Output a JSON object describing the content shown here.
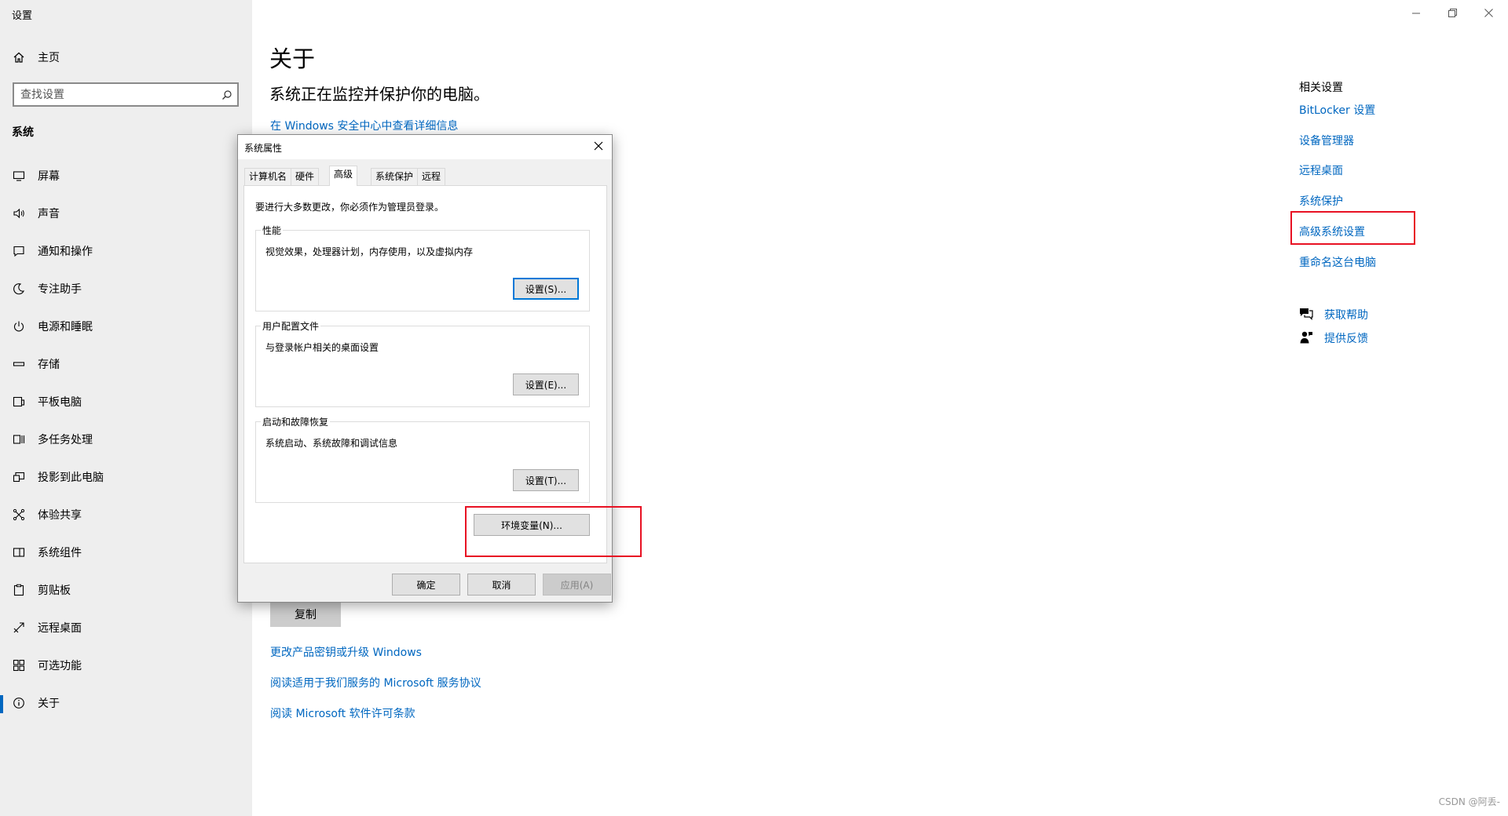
{
  "window": {
    "app_title": "设置"
  },
  "sidebar": {
    "home_label": "主页",
    "search_placeholder": "查找设置",
    "section_label": "系统",
    "items": [
      {
        "label": "屏幕",
        "icon": "monitor-icon"
      },
      {
        "label": "声音",
        "icon": "speaker-icon"
      },
      {
        "label": "通知和操作",
        "icon": "notification-icon"
      },
      {
        "label": "专注助手",
        "icon": "moon-icon"
      },
      {
        "label": "电源和睡眠",
        "icon": "power-icon"
      },
      {
        "label": "存储",
        "icon": "storage-icon"
      },
      {
        "label": "平板电脑",
        "icon": "tablet-icon"
      },
      {
        "label": "多任务处理",
        "icon": "multitask-icon"
      },
      {
        "label": "投影到此电脑",
        "icon": "project-icon"
      },
      {
        "label": "体验共享",
        "icon": "share-icon"
      },
      {
        "label": "系统组件",
        "icon": "components-icon"
      },
      {
        "label": "剪贴板",
        "icon": "clipboard-icon"
      },
      {
        "label": "远程桌面",
        "icon": "remote-icon"
      },
      {
        "label": "可选功能",
        "icon": "features-icon"
      },
      {
        "label": "关于",
        "icon": "info-icon",
        "active": true
      }
    ]
  },
  "main": {
    "title": "关于",
    "subtitle": "系统正在监控并保护你的电脑。",
    "security_link": "在 Windows 安全中心中查看详细信息",
    "copy_button": "复制",
    "links": [
      "更改产品密钥或升级 Windows",
      "阅读适用于我们服务的 Microsoft 服务协议",
      "阅读 Microsoft 软件许可条款"
    ]
  },
  "related": {
    "title": "相关设置",
    "links": [
      "BitLocker 设置",
      "设备管理器",
      "远程桌面",
      "系统保护",
      "高级系统设置",
      "重命名这台电脑"
    ],
    "help": [
      {
        "label": "获取帮助",
        "icon": "help-chat-icon"
      },
      {
        "label": "提供反馈",
        "icon": "feedback-icon"
      }
    ]
  },
  "dialog": {
    "title": "系统属性",
    "tabs": [
      "计算机名",
      "硬件",
      "高级",
      "系统保护",
      "远程"
    ],
    "active_tab": "高级",
    "admin_note": "要进行大多数更改，你必须作为管理员登录。",
    "groups": [
      {
        "title": "性能",
        "desc": "视觉效果，处理器计划，内存使用，以及虚拟内存",
        "button": "设置(S)..."
      },
      {
        "title": "用户配置文件",
        "desc": "与登录帐户相关的桌面设置",
        "button": "设置(E)..."
      },
      {
        "title": "启动和故障恢复",
        "desc": "系统启动、系统故障和调试信息",
        "button": "设置(T)..."
      }
    ],
    "env_button": "环境变量(N)...",
    "ok_button": "确定",
    "cancel_button": "取消",
    "apply_button": "应用(A)"
  },
  "watermark": "CSDN @阿丢-",
  "colors": {
    "link": "#0067c0",
    "highlight": "#e81123",
    "sidebar_bg": "#eeeeee",
    "accent": "#0078d7"
  }
}
